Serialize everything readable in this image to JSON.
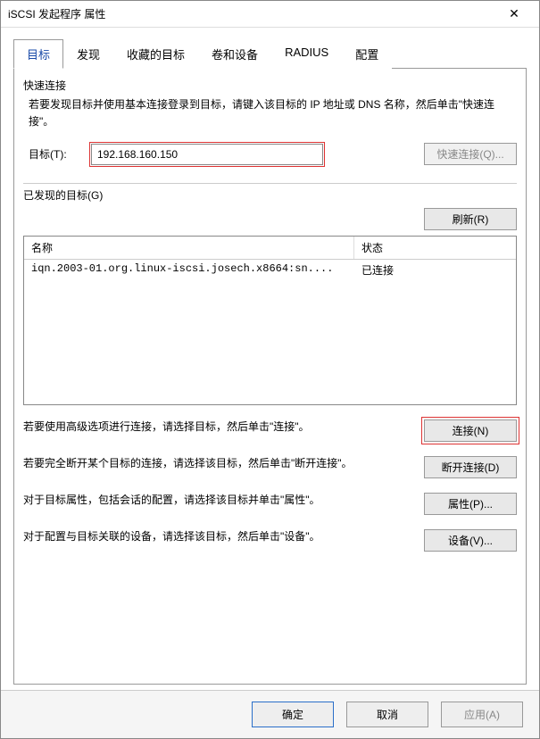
{
  "window": {
    "title": "iSCSI 发起程序 属性",
    "close_glyph": "✕"
  },
  "tabs": {
    "items": [
      {
        "label": "目标"
      },
      {
        "label": "发现"
      },
      {
        "label": "收藏的目标"
      },
      {
        "label": "卷和设备"
      },
      {
        "label": "RADIUS"
      },
      {
        "label": "配置"
      }
    ]
  },
  "quick_connect": {
    "section_label": "快速连接",
    "description": "若要发现目标并使用基本连接登录到目标，请键入该目标的 IP 地址或 DNS 名称，然后单击\"快速连接\"。",
    "target_label": "目标(T):",
    "target_value": "192.168.160.150",
    "button_label": "快速连接(Q)..."
  },
  "discovered": {
    "section_label": "已发现的目标(G)",
    "refresh_label": "刷新(R)",
    "columns": {
      "name": "名称",
      "status": "状态"
    },
    "rows": [
      {
        "name": "iqn.2003-01.org.linux-iscsi.josech.x8664:sn....",
        "status": "已连接"
      }
    ]
  },
  "help": {
    "connect": {
      "text": "若要使用高级选项进行连接，请选择目标，然后单击\"连接\"。",
      "button": "连接(N)"
    },
    "disconnect": {
      "text": "若要完全断开某个目标的连接，请选择该目标，然后单击\"断开连接\"。",
      "button": "断开连接(D)"
    },
    "properties": {
      "text": "对于目标属性，包括会话的配置，请选择该目标并单击\"属性\"。",
      "button": "属性(P)..."
    },
    "devices": {
      "text": "对于配置与目标关联的设备，请选择该目标，然后单击\"设备\"。",
      "button": "设备(V)..."
    }
  },
  "footer": {
    "ok": "确定",
    "cancel": "取消",
    "apply": "应用(A)"
  }
}
